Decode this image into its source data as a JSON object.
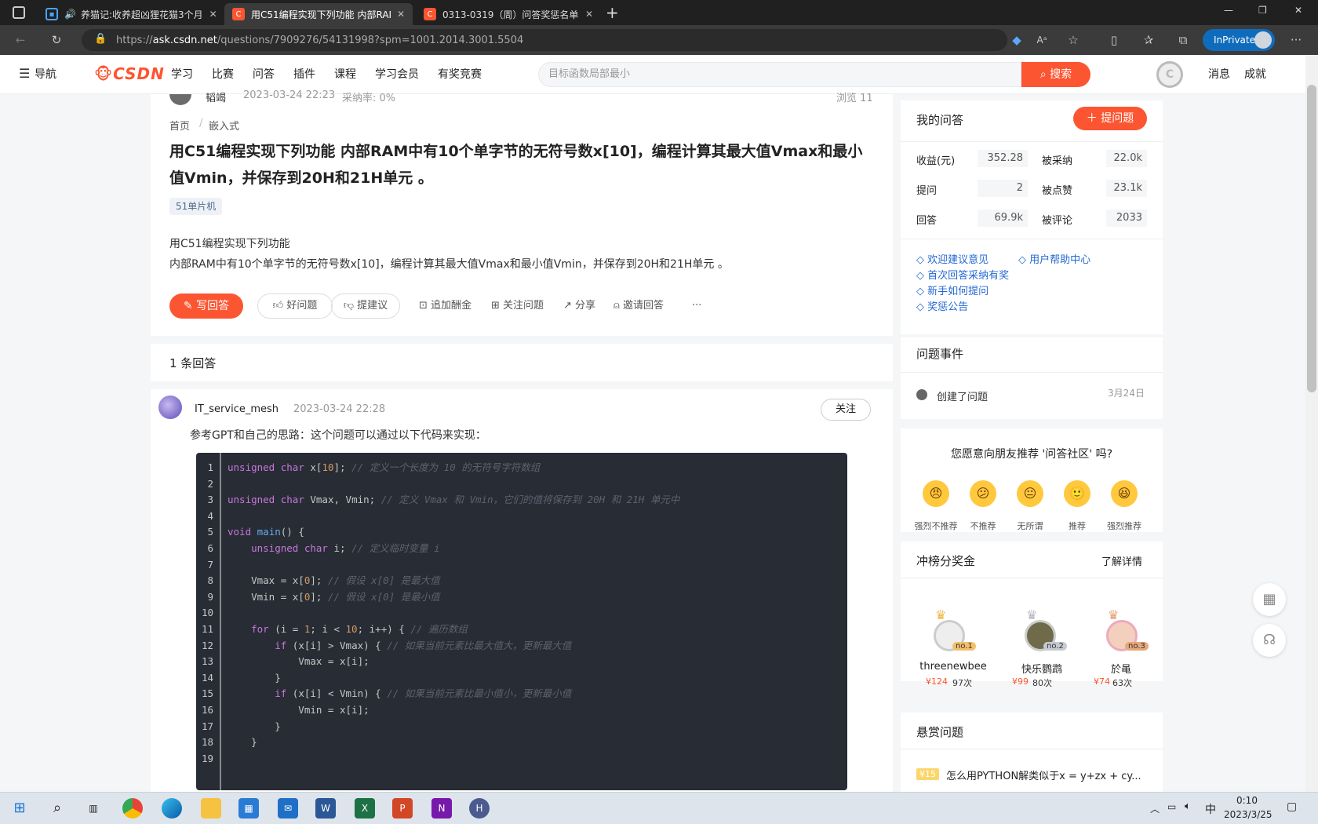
{
  "browser": {
    "tabs": [
      {
        "title": "养猫记:收养超凶狸花猫3个月",
        "icon": "media-tab-icon"
      },
      {
        "title": "用C51编程实现下列功能 内部RAM",
        "icon": "csdn-logo"
      },
      {
        "title": "0313-0319（周）问答奖惩名单公",
        "icon": "csdn-logo"
      }
    ],
    "url_prefix": "https://",
    "url_host": "ask.csdn.net",
    "url_path": "/questions/7909276/54131998?spm=1001.2014.3001.5504",
    "inprivate_label": "InPrivate"
  },
  "header": {
    "nav_label": "导航",
    "logo_text": "CSDN",
    "menu": [
      "学习",
      "比赛",
      "问答",
      "插件",
      "课程",
      "学习会员",
      "有奖竞赛"
    ],
    "search_placeholder": "目标函数局部最小",
    "search_button": "搜索",
    "right_links": [
      "消息",
      "成就"
    ]
  },
  "question": {
    "author": "韬竭",
    "date": "2023-03-24 22:23",
    "accept_rate": "采纳率: 0%",
    "views": "浏览 11",
    "breadcrumb": [
      "首页",
      "嵌入式"
    ],
    "title": "用C51编程实现下列功能 内部RAM中有10个单字节的无符号数x[10]，编程计算其最大值Vmax和最小值Vmin，并保存到20H和21H单元 。",
    "tag": "51单片机",
    "body_line1": "用C51编程实现下列功能",
    "body_line2": "内部RAM中有10个单字节的无符号数x[10]，编程计算其最大值Vmax和最小值Vmin，并保存到20H和21H单元 。",
    "actions": {
      "write_answer": "写回答",
      "good_question": "好问题",
      "suggest": "提建议",
      "add_bounty": "追加酬金",
      "follow": "关注问题",
      "share": "分享",
      "invite": "邀请回答",
      "more": "···"
    }
  },
  "answers": {
    "count_label": "1 条回答",
    "items": [
      {
        "author": "IT_service_mesh",
        "date": "2023-03-24 22:28",
        "follow_label": "关注",
        "intro": "参考GPT和自己的思路：这个问题可以通过以下代码来实现：",
        "code": [
          "unsigned char x[10]; // 定义一个长度为 10 的无符号字符数组",
          "",
          "unsigned char Vmax, Vmin; // 定义 Vmax 和 Vmin，它们的值将保存到 20H 和 21H 单元中",
          "",
          "void main() {",
          "    unsigned char i; // 定义临时变量 i",
          "",
          "    Vmax = x[0]; // 假设 x[0] 是最大值",
          "    Vmin = x[0]; // 假设 x[0] 是最小值",
          "",
          "    for (i = 1; i < 10; i++) { // 遍历数组",
          "        if (x[i] > Vmax) { // 如果当前元素比最大值大，更新最大值",
          "            Vmax = x[i];",
          "        }",
          "        if (x[i] < Vmin) { // 如果当前元素比最小值小，更新最小值",
          "            Vmin = x[i];",
          "        }",
          "    }",
          ""
        ]
      }
    ]
  },
  "sidebar": {
    "my_answers": {
      "title": "我的问答",
      "ask_button": "提问题",
      "stats": [
        {
          "label": "收益(元)",
          "value": "352.28",
          "label2": "被采纳",
          "value2": "22.0k"
        },
        {
          "label": "提问",
          "value": "2",
          "label2": "被点赞",
          "value2": "23.1k"
        },
        {
          "label": "回答",
          "value": "69.9k",
          "label2": "被评论",
          "value2": "2033"
        }
      ],
      "links": [
        "欢迎建议意见",
        "用户帮助中心",
        "首次回答采纳有奖",
        "新手如何提问",
        "奖惩公告"
      ]
    },
    "events": {
      "title": "问题事件",
      "items": [
        {
          "text": "创建了问题",
          "date": "3月24日"
        }
      ]
    },
    "recommend": {
      "question": "您愿意向朋友推荐 '问答社区' 吗?",
      "options": [
        "强烈不推荐",
        "不推荐",
        "无所谓",
        "推荐",
        "强烈推荐"
      ]
    },
    "leaderboard": {
      "title": "冲榜分奖金",
      "more": "了解详情",
      "users": [
        {
          "name": "threenewbee",
          "rank": "no.1",
          "money": "¥124",
          "times": "97次"
        },
        {
          "name": "快乐鹦鹉",
          "rank": "no.2",
          "money": "¥99",
          "times": "80次"
        },
        {
          "name": "於黾",
          "rank": "no.3",
          "money": "¥74",
          "times": "63次"
        }
      ]
    },
    "bounty": {
      "title": "悬赏问题",
      "items": [
        {
          "amount": "¥15",
          "text": "怎么用PYTHON解类似于x = y+zx + cy..."
        }
      ]
    }
  },
  "taskbar": {
    "time": "0:10",
    "date": "2023/3/25",
    "ime": "中"
  }
}
